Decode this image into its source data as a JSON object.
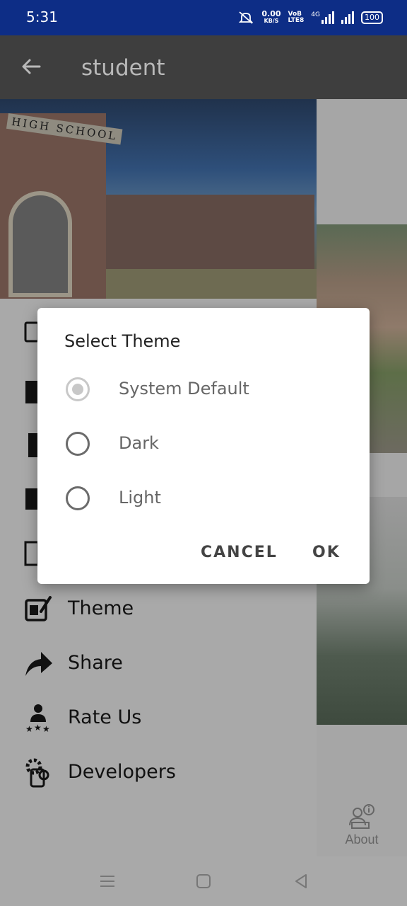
{
  "status_bar": {
    "time": "5:31",
    "net_speed_value": "0.00",
    "net_speed_unit": "KB/S",
    "volte_top": "VoB",
    "volte_bottom": "LTE8",
    "network_type": "4G",
    "battery": "100"
  },
  "app_bar": {
    "title": "student"
  },
  "drawer": {
    "header_sign": "HIGH SCHOOL",
    "items": [
      {
        "label": "Theme",
        "icon": "theme-edit-icon"
      },
      {
        "label": "Share",
        "icon": "share-arrow-icon"
      },
      {
        "label": "Rate Us",
        "icon": "rate-us-icon"
      },
      {
        "label": "Developers",
        "icon": "developers-icon"
      }
    ]
  },
  "bottom_nav": {
    "about_label": "About"
  },
  "dialog": {
    "title": "Select Theme",
    "options": [
      {
        "label": "System Default",
        "selected": true
      },
      {
        "label": "Dark",
        "selected": false
      },
      {
        "label": "Light",
        "selected": false
      }
    ],
    "cancel_label": "CANCEL",
    "ok_label": "OK"
  },
  "colors": {
    "status_bar": "#0d2d86",
    "app_bar": "#3e3e3e",
    "scrim": "#a9a9a9",
    "dialog": "#ffffff"
  }
}
